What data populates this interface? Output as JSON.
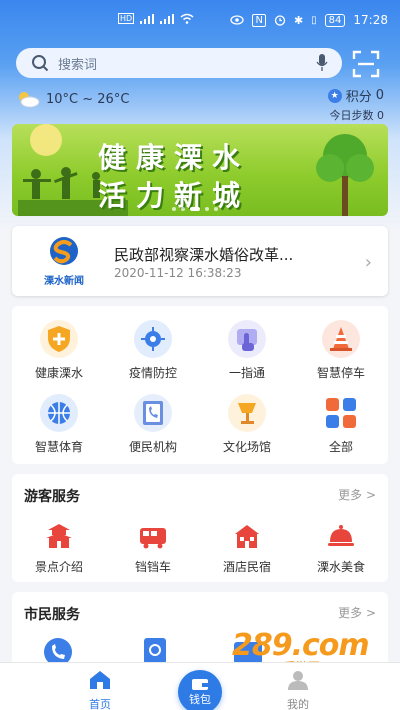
{
  "status_bar": {
    "left_icons": [
      "hd-icon",
      "signal-icon",
      "signal-icon",
      "wifi-icon"
    ],
    "right_icons": [
      "eye-icon",
      "nfc-icon",
      "alarm-icon",
      "bluetooth-icon",
      "vibrate-icon"
    ],
    "battery": "84",
    "time": "17:28"
  },
  "search": {
    "placeholder": "搜索词"
  },
  "weather": {
    "temp": "10°C ~ 26°C"
  },
  "points": {
    "label": "积分",
    "value": "0",
    "steps_label": "今日步数",
    "steps_value": "0"
  },
  "banner": {
    "line1": "健康溧水",
    "line2": "活力新城",
    "slides": 5,
    "active_slide": 3
  },
  "news": {
    "logo_label": "溧水新闻",
    "title": "民政部视察溧水婚俗改革...",
    "time": "2020-11-12 16:38:23"
  },
  "grid": {
    "items": [
      {
        "label": "健康溧水",
        "icon": "shield-plus-icon",
        "color": "#f5a623"
      },
      {
        "label": "疫情防控",
        "icon": "virus-icon",
        "color": "#3c7ee8"
      },
      {
        "label": "一指通",
        "icon": "hand-pointer-icon",
        "color": "#8b86e8"
      },
      {
        "label": "智慧停车",
        "icon": "traffic-cone-icon",
        "color": "#f06a3a"
      },
      {
        "label": "智慧体育",
        "icon": "basketball-icon",
        "color": "#3c7ee8"
      },
      {
        "label": "便民机构",
        "icon": "phone-book-icon",
        "color": "#6a8fe0"
      },
      {
        "label": "文化场馆",
        "icon": "lamp-icon",
        "color": "#f5a623"
      },
      {
        "label": "全部",
        "icon": "apps-grid-icon",
        "color": "#f06a3a"
      }
    ]
  },
  "tourist": {
    "title": "游客服务",
    "more": "更多 >",
    "items": [
      {
        "label": "景点介绍",
        "icon": "pagoda-icon"
      },
      {
        "label": "铛铛车",
        "icon": "tram-icon"
      },
      {
        "label": "酒店民宿",
        "icon": "hotel-icon"
      },
      {
        "label": "溧水美食",
        "icon": "food-cover-icon"
      }
    ]
  },
  "citizen": {
    "title": "市民服务",
    "more": "更多 >"
  },
  "tabs": {
    "home": "首页",
    "wallet": "钱包",
    "mine": "我的"
  },
  "watermark": {
    "big": "289.com",
    "small": "手游网"
  },
  "colors": {
    "primary": "#2e7be6",
    "accent_red": "#e8453c"
  }
}
